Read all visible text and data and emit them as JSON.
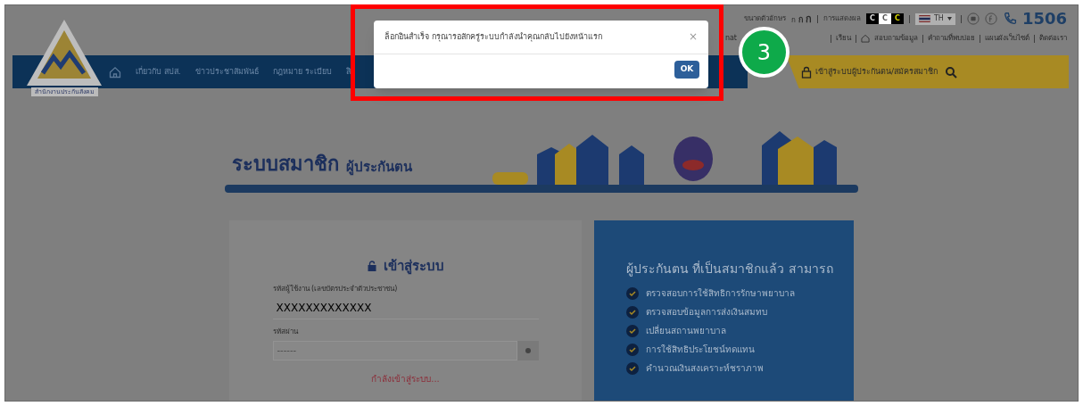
{
  "top_bar": {
    "font_size_label": "ขนาดตัวอักษร",
    "font_sizes": [
      "ก",
      "ก",
      "ก"
    ],
    "display_label": "การแสดงผล",
    "display_modes": [
      {
        "label": "C",
        "color": "#000000"
      },
      {
        "label": "C",
        "color": "#ffffff"
      },
      {
        "label": "C",
        "color": "#000000"
      }
    ],
    "language": "TH",
    "phone": "1506"
  },
  "quick_links": [
    "nat",
    "เรียน",
    "สอบถามข้อมูล",
    "คำถามที่พบบ่อย",
    "แผนผังเว็บไซต์",
    "ติดต่อเรา"
  ],
  "logo_caption": "สำนักงานประกันสังคม",
  "nav": {
    "items": [
      "เกี่ยวกับ สปส.",
      "ข่าวประชาสัมพันธ์",
      "กฎหมาย ระเบียบ",
      "สิ"
    ],
    "login_link": "เข้าสู่ระบบผู้ประกันตน/สมัครสมาชิก"
  },
  "banner": {
    "title": "ระบบสมาชิก",
    "subtitle": "ผู้ประกันตน"
  },
  "login": {
    "heading": "เข้าสู่ระบบ",
    "user_label": "รหัสผู้ใช้งาน (เลขบัตรประจำตัวประชาชน)",
    "user_value": "XXXXXXXXXXXXX",
    "password_label": "รหัสผ่าน",
    "password_placeholder": "------",
    "status": "กำลังเข้าสู่ระบบ..."
  },
  "benefits": {
    "title": "ผู้ประกันตน ที่เป็นสมาชิกแล้ว สามารถ",
    "items": [
      "ตรวจสอบการใช้สิทธิการรักษาพยาบาล",
      "ตรวจสอบข้อมูลการส่งเงินสมทบ",
      "เปลี่ยนสถานพยาบาล",
      "การใช้สิทธิประโยชน์ทดแทน",
      "คำนวณเงินสงเคราะห์ชราภาพ"
    ]
  },
  "dialog": {
    "message": "ล็อกอินสำเร็จ กรุณารอสักครู่ระบบกำลังนำคุณกลับไปยังหน้าแรก",
    "close": "×",
    "button": "OK"
  },
  "annotation": {
    "step": "3"
  }
}
